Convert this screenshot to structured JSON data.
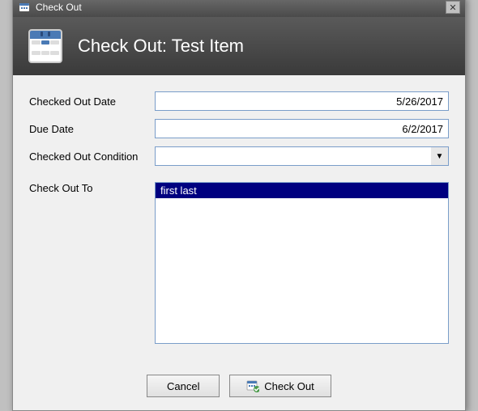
{
  "window": {
    "title": "Check Out",
    "header_title": "Check Out: Test Item"
  },
  "form": {
    "checked_out_date_label": "Checked Out Date",
    "checked_out_date_value": "5/26/2017",
    "due_date_label": "Due Date",
    "due_date_value": "6/2/2017",
    "checked_out_condition_label": "Checked Out Condition",
    "checked_out_condition_value": "",
    "check_out_to_label": "Check Out To",
    "check_out_to_selected": "first last"
  },
  "buttons": {
    "cancel_label": "Cancel",
    "checkout_label": "Check Out"
  },
  "icons": {
    "close": "✕",
    "dropdown_arrow": "▼",
    "calendar": "📅"
  }
}
